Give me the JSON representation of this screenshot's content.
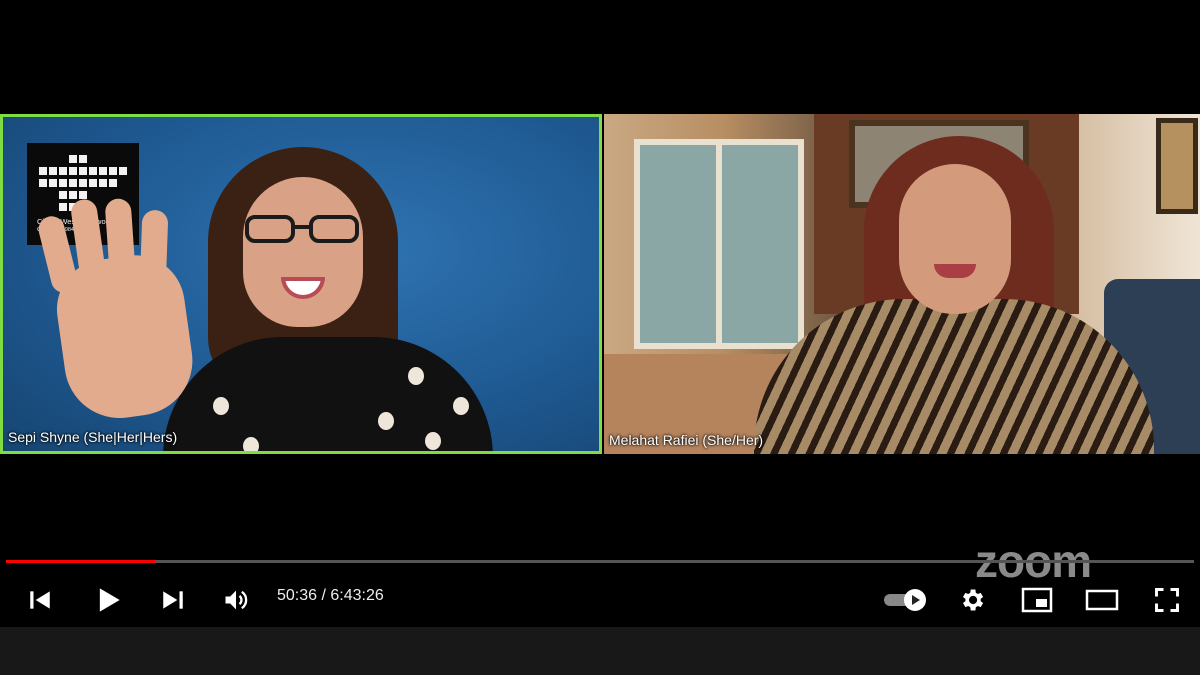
{
  "video": {
    "participants": [
      {
        "name": "Sepi Shyne (She|Her|Hers)",
        "active_speaker": true
      },
      {
        "name": "Melahat Rafiei (She/Her)",
        "active_speaker": false
      }
    ],
    "logo": {
      "line1": "City of West Hollywood",
      "line2": "California 1984"
    },
    "watermark": "zoom"
  },
  "player": {
    "current_time": "50:36",
    "separator": " / ",
    "duration": "6:43:26",
    "progress_fraction": 0.1251,
    "colors": {
      "progress": "#ff0000",
      "track": "#555555",
      "active_speaker_border": "#7fdc43"
    },
    "icons": [
      "previous-icon",
      "play-icon",
      "next-icon",
      "volume-icon",
      "autoplay-toggle-icon",
      "settings-icon",
      "miniplayer-icon",
      "theater-mode-icon",
      "fullscreen-icon"
    ]
  }
}
